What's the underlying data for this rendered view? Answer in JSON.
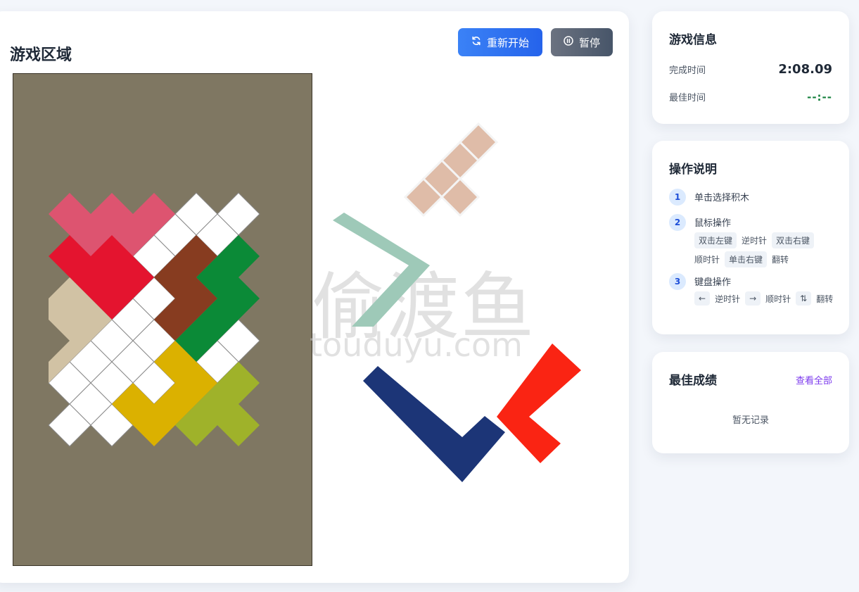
{
  "game": {
    "title": "游戏区域",
    "restart_label": "重新开始",
    "pause_label": "暂停",
    "restart_icon": "refresh-icon",
    "pause_icon": "pause-circle-icon",
    "board_color": "#7f7762",
    "watermark_cn": "偷渡鱼",
    "watermark_en": "touduyu.com",
    "placed_pieces": [
      {
        "name": "pink-piece",
        "color": "#dd5470"
      },
      {
        "name": "red-piece",
        "color": "#e4142f"
      },
      {
        "name": "brown-piece",
        "color": "#873c20"
      },
      {
        "name": "green-piece",
        "color": "#0b8a37"
      },
      {
        "name": "beige-piece",
        "color": "#d1c2a4"
      },
      {
        "name": "yellow-piece",
        "color": "#dbb100"
      },
      {
        "name": "olive-piece",
        "color": "#9fb22a"
      }
    ],
    "free_pieces": [
      {
        "name": "peach-piece",
        "color": "#dfbca8"
      },
      {
        "name": "mint-piece",
        "color": "#9ec9b8"
      },
      {
        "name": "navy-piece",
        "color": "#1c3577"
      },
      {
        "name": "orange-red-piece",
        "color": "#fa2413"
      }
    ]
  },
  "info": {
    "title": "游戏信息",
    "time_label": "完成时间",
    "time_value": "2:08.09",
    "best_label": "最佳时间",
    "best_value": "--:--"
  },
  "help": {
    "title": "操作说明",
    "step1": {
      "num": "1",
      "text": "单击选择积木"
    },
    "step2": {
      "num": "2",
      "text": "鼠标操作",
      "k1": "双击左键",
      "v1": "逆时针",
      "k2": "双击右键",
      "v2": "顺时针",
      "k3": "单击右键",
      "v3": "翻转"
    },
    "step3": {
      "num": "3",
      "text": "键盘操作",
      "k1": "←",
      "v1": "逆时针",
      "k2": "→",
      "v2": "顺时针",
      "k3": "⇅",
      "v3": "翻转"
    }
  },
  "scores": {
    "title": "最佳成绩",
    "view_all": "查看全部",
    "empty": "暂无记录"
  }
}
